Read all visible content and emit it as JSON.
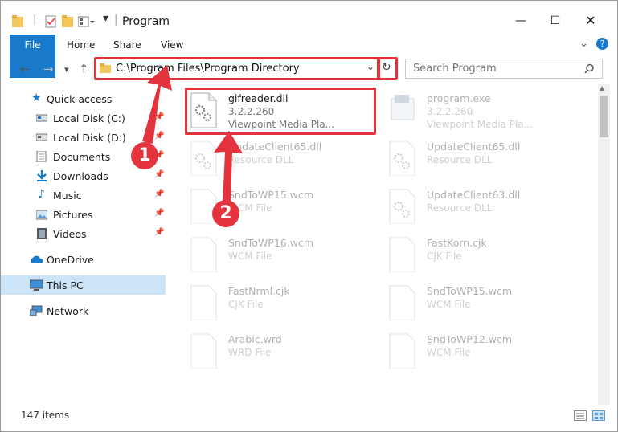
{
  "window": {
    "title": "Program"
  },
  "ribbon": {
    "tabs": [
      "File",
      "Home",
      "Share",
      "View"
    ]
  },
  "address": {
    "path": "C:\\Program Files\\Program Directory"
  },
  "search": {
    "placeholder": "Search Program"
  },
  "sidebar": {
    "quick_access": "Quick access",
    "items": [
      {
        "label": "Local Disk (C:)",
        "icon": "drive-icon"
      },
      {
        "label": "Local Disk (D:)",
        "icon": "drive-icon"
      },
      {
        "label": "Documents",
        "icon": "documents-icon"
      },
      {
        "label": "Downloads",
        "icon": "downloads-icon"
      },
      {
        "label": "Music",
        "icon": "music-icon"
      },
      {
        "label": "Pictures",
        "icon": "pictures-icon"
      },
      {
        "label": "Videos",
        "icon": "videos-icon"
      }
    ],
    "onedrive": "OneDrive",
    "this_pc": "This PC",
    "network": "Network"
  },
  "files": {
    "left": [
      {
        "name": "gifreader.dll",
        "l1": "3.2.2.260",
        "l2": "Viewpoint Media Pla..."
      },
      {
        "name": "UpdateClient65.dll",
        "l1": "Resource DLL",
        "l2": ""
      },
      {
        "name": "SndToWP15.wcm",
        "l1": "WCM File",
        "l2": ""
      },
      {
        "name": "SndToWP16.wcm",
        "l1": "WCM File",
        "l2": ""
      },
      {
        "name": "FastNrml.cjk",
        "l1": "CJK File",
        "l2": ""
      },
      {
        "name": "Arabic.wrd",
        "l1": "WRD File",
        "l2": ""
      }
    ],
    "right": [
      {
        "name": "program.exe",
        "l1": "3.2.2.260",
        "l2": "Viewpoint Media Pla..."
      },
      {
        "name": "UpdateClient65.dll",
        "l1": "Resource DLL",
        "l2": ""
      },
      {
        "name": "UpdateClient63.dll",
        "l1": "Resource DLL",
        "l2": ""
      },
      {
        "name": "FastKorn.cjk",
        "l1": "CJK File",
        "l2": ""
      },
      {
        "name": "SndToWP15.wcm",
        "l1": "WCM File",
        "l2": ""
      },
      {
        "name": "SndToWP12.wcm",
        "l1": "WCM File",
        "l2": ""
      }
    ]
  },
  "status": {
    "count": "147 items"
  },
  "callouts": {
    "one": "1",
    "two": "2"
  },
  "colors": {
    "accent": "#1979ca",
    "highlight": "#e3343e",
    "selected": "#cce4f7"
  }
}
